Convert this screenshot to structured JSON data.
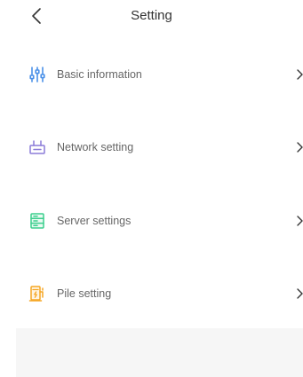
{
  "header": {
    "title": "Setting"
  },
  "menu": {
    "items": [
      {
        "label": "Basic information",
        "icon": "sliders-icon"
      },
      {
        "label": "Network setting",
        "icon": "network-icon"
      },
      {
        "label": "Server settings",
        "icon": "server-icon"
      },
      {
        "label": "Pile setting",
        "icon": "charging-pile-icon"
      }
    ]
  },
  "colors": {
    "sliders_icon": "#4a90e8",
    "network_icon": "#8b7bd8",
    "server_icon": "#3ccf8e",
    "pile_icon": "#f5a623",
    "label_text": "#666666",
    "title_text": "#333333",
    "footer_background": "#f6f6f6"
  }
}
